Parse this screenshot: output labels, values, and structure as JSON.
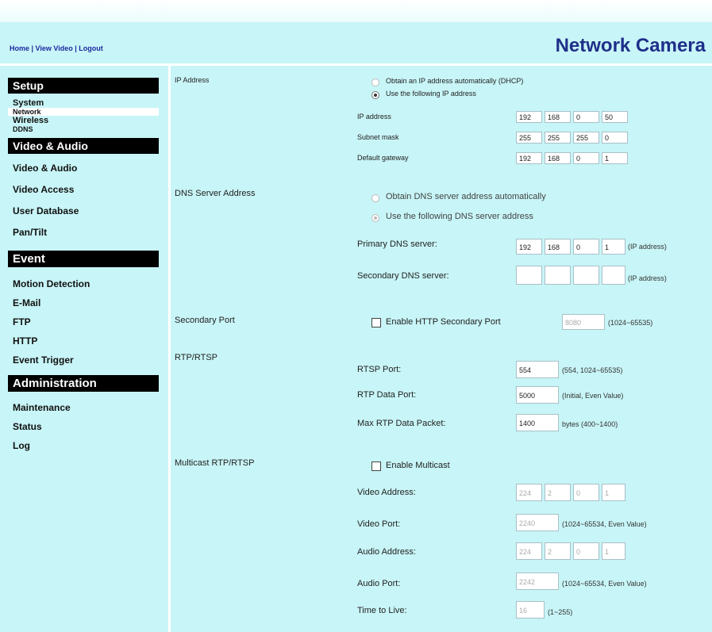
{
  "header": {
    "links": [
      "Home",
      "View Video",
      "Logout"
    ],
    "brand": "Network Camera"
  },
  "sidebar": {
    "setup_title": "Setup",
    "setup_items": [
      "System",
      "Network",
      "Wireless",
      "DDNS"
    ],
    "av_title": "Video & Audio",
    "av_items": [
      "Video & Audio",
      "Video Access",
      "User Database",
      "Pan/Tilt"
    ],
    "event_title": "Event",
    "event_items": [
      "Motion Detection",
      "E-Mail",
      "FTP",
      "HTTP",
      "Event Trigger"
    ],
    "admin_title": "Administration",
    "admin_items": [
      "Maintenance",
      "Status",
      "Log"
    ]
  },
  "ip": {
    "section": "IP Address",
    "opt_auto": "Obtain an IP address automatically (DHCP)",
    "opt_manual": "Use the following IP address",
    "ip_label": "IP address",
    "ip": [
      "192",
      "168",
      "0",
      "50"
    ],
    "mask_label": "Subnet mask",
    "mask": [
      "255",
      "255",
      "255",
      "0"
    ],
    "gw_label": "Default gateway",
    "gw": [
      "192",
      "168",
      "0",
      "1"
    ]
  },
  "dns": {
    "section": "DNS Server Address",
    "opt_auto": "Obtain DNS server address automatically",
    "opt_manual": "Use the following DNS server address",
    "primary_label": "Primary DNS server:",
    "primary": [
      "192",
      "168",
      "0",
      "1"
    ],
    "primary_note": "(IP address)",
    "secondary_label": "Secondary DNS server:",
    "secondary": [
      "",
      "",
      "",
      ""
    ],
    "secondary_note": "(IP address)"
  },
  "secondary_port": {
    "section": "Secondary Port",
    "enable": "Enable HTTP Secondary Port",
    "value": "8080",
    "note": "(1024~65535)"
  },
  "rtp": {
    "section": "RTP/RTSP",
    "rtsp_label": "RTSP Port:",
    "rtsp": "554",
    "rtsp_note": "(554, 1024~65535)",
    "data_label": "RTP Data Port:",
    "data": "5000",
    "data_note": "(Initial, Even Value)",
    "max_label": "Max RTP Data Packet:",
    "max": "1400",
    "max_note": "bytes (400~1400)"
  },
  "multicast": {
    "section": "Multicast RTP/RTSP",
    "enable": "Enable Multicast",
    "video_addr_label": "Video Address:",
    "video_addr": [
      "224",
      "2",
      "0",
      "1"
    ],
    "video_port_label": "Video Port:",
    "video_port": "2240",
    "video_port_note": "(1024~65534, Even Value)",
    "audio_addr_label": "Audio Address:",
    "audio_addr": [
      "224",
      "2",
      "0",
      "1"
    ],
    "audio_port_label": "Audio Port:",
    "audio_port": "2242",
    "audio_port_note": "(1024~65534, Even Value)",
    "ttl_label": "Time to Live:",
    "ttl": "16",
    "ttl_note": "(1~255)"
  }
}
